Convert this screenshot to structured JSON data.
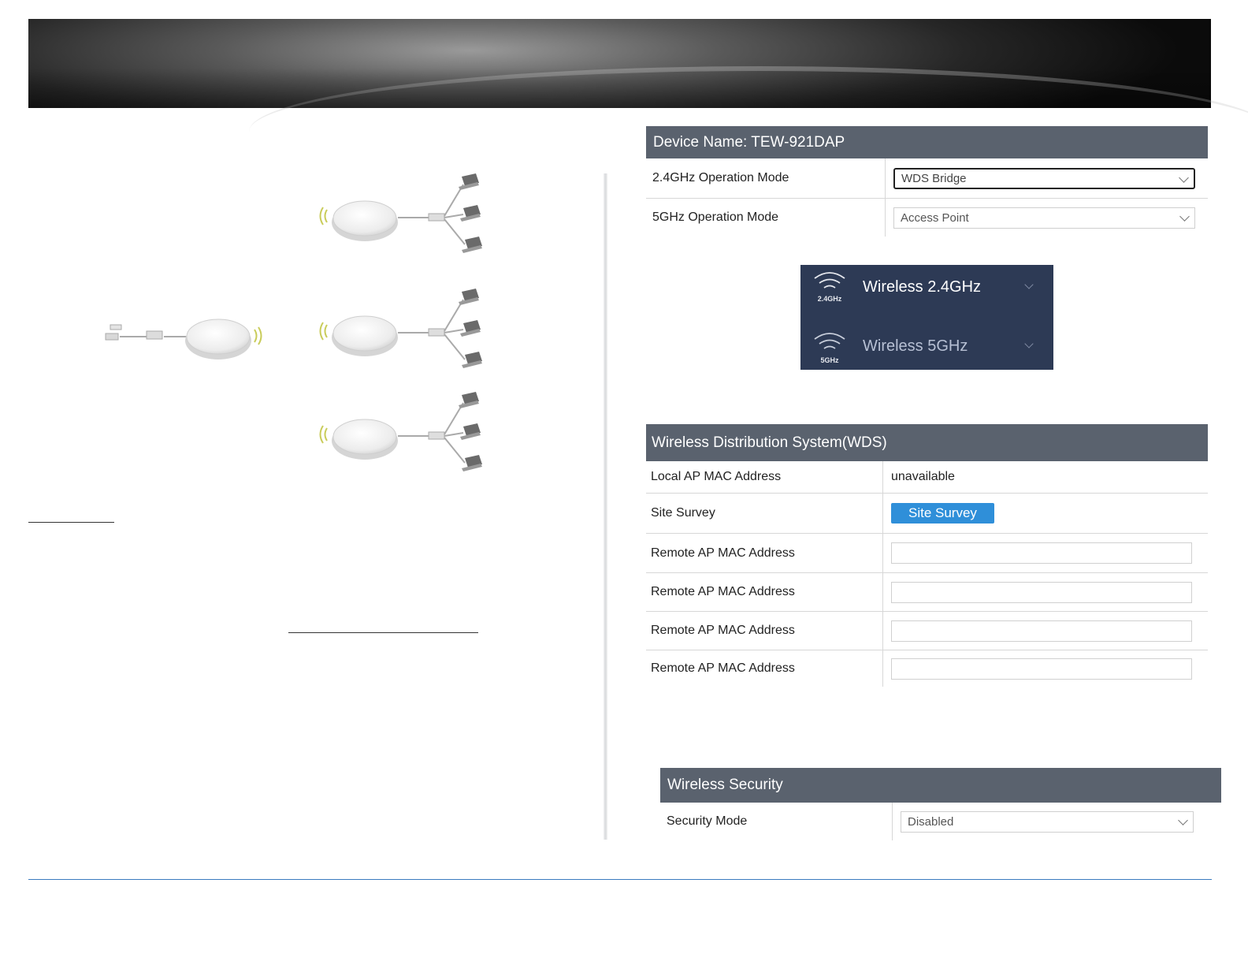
{
  "device_panel": {
    "title": "Device Name: TEW-921DAP",
    "rows": [
      {
        "label": "2.4GHz Operation Mode",
        "value": "WDS Bridge"
      },
      {
        "label": "5GHz Operation Mode",
        "value": "Access Point"
      }
    ]
  },
  "wireless_menu": {
    "items": [
      {
        "label": "Wireless 2.4GHz",
        "badge": "2.4GHz",
        "icon": "wifi-icon"
      },
      {
        "label": "Wireless 5GHz",
        "badge": "5GHz",
        "icon": "wifi-icon"
      }
    ]
  },
  "wds_panel": {
    "title": "Wireless Distribution System(WDS)",
    "local_mac_label": "Local AP MAC Address",
    "local_mac_value": "unavailable",
    "site_survey_label": "Site Survey",
    "site_survey_button": "Site Survey",
    "remote_rows": [
      {
        "label": "Remote AP MAC Address",
        "value": ""
      },
      {
        "label": "Remote AP MAC Address",
        "value": ""
      },
      {
        "label": "Remote AP MAC Address",
        "value": ""
      },
      {
        "label": "Remote AP MAC Address",
        "value": ""
      }
    ]
  },
  "security_panel": {
    "title": "Wireless Security",
    "mode_label": "Security Mode",
    "mode_value": "Disabled"
  },
  "colors": {
    "panel_header": "#5a626e",
    "menu_bg": "#2d3a55",
    "button": "#2f8fd9",
    "footer_rule": "#3a7bbf"
  }
}
